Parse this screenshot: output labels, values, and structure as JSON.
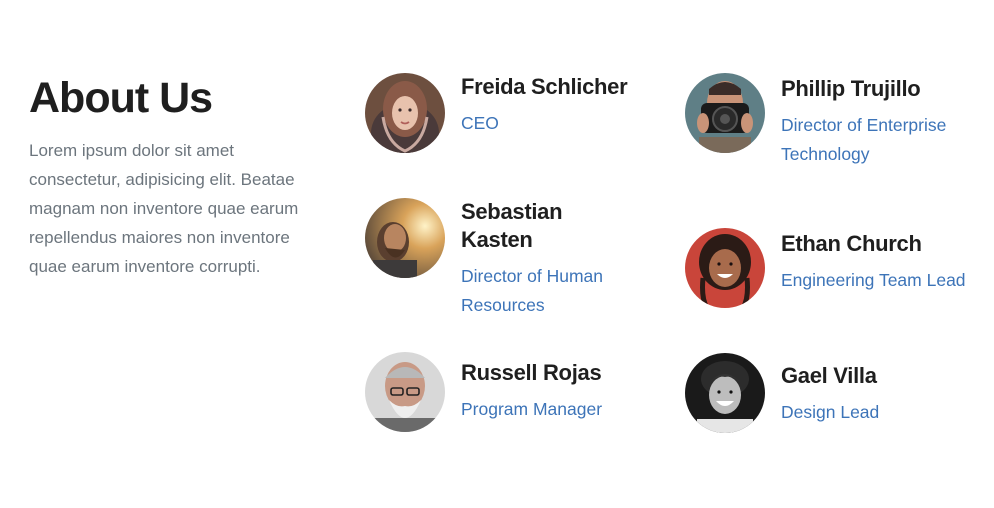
{
  "about": {
    "title": "About Us",
    "description": "Lorem ipsum dolor sit amet consectetur, adipisicing elit. Beatae magnam non inventore quae earum repellendus maiores non inventore quae earum inventore corrupti."
  },
  "team": [
    {
      "name": "Freida Schlicher",
      "role": "CEO"
    },
    {
      "name": "Sebastian Kasten",
      "role": "Director of Human Resources"
    },
    {
      "name": "Russell Rojas",
      "role": "Program Manager"
    },
    {
      "name": "Phillip Trujillo",
      "role": "Director of Enterprise Technology"
    },
    {
      "name": "Ethan Church",
      "role": "Engineering Team Lead"
    },
    {
      "name": "Gael Villa",
      "role": "Design Lead"
    }
  ],
  "colors": {
    "heading": "#1f1f1f",
    "body_text": "#6c757d",
    "role_link": "#3d74b8"
  }
}
